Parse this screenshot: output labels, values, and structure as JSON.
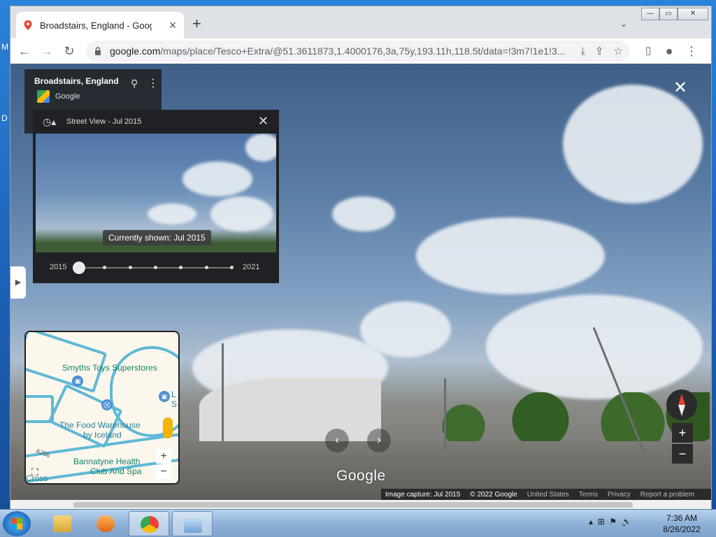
{
  "desktop": {
    "letter_m": "M",
    "letter_d": "D"
  },
  "browser": {
    "tab": {
      "title": "Broadstairs, England - Google Maps",
      "close": "✕"
    },
    "newtab": "+",
    "tab_search": "⌄",
    "window_controls": {
      "minimize": "—",
      "maximize": "▭",
      "close": "✕"
    },
    "nav": {
      "back": "←",
      "forward": "→",
      "reload": "↻"
    },
    "url": {
      "host": "google.com",
      "path": "/maps/place/Tesco+Extra/@51.3611873,1.4000176,3a,75y,193.11h,118.5t/data=!3m7!1e1!3..."
    }
  },
  "streetview": {
    "close": "✕",
    "place": {
      "title": "Broadstairs, England",
      "brand": "Google"
    },
    "time_machine": {
      "title": "Street View - Jul 2015",
      "tooltip": "Currently shown: Jul 2015",
      "year_start": "2015",
      "year_end": "2021",
      "stops": 7,
      "selected_index": 0
    },
    "minimap": {
      "labels": {
        "smyths": "Smyths Toys Superstores",
        "food_warehouse": "The Food Warehouse",
        "by_iceland": "by Iceland",
        "bannatyne": "Bannatyne Health",
        "club_spa": "Club And Spa",
        "road": "A256",
        "cross": "Cross",
        "partial_l": "L",
        "partial_s": "S"
      },
      "zoom_in": "+",
      "zoom_out": "−"
    },
    "logo": "Google",
    "footer": {
      "capture": "Image capture: Jul 2015",
      "copyright": "© 2022 Google",
      "country": "United States",
      "terms": "Terms",
      "privacy": "Privacy",
      "report": "Report a problem"
    },
    "zoom_in": "+",
    "zoom_out": "−",
    "nav_left": "‹",
    "nav_right": "›"
  },
  "taskbar": {
    "time": "7:36 AM",
    "date": "8/26/2022"
  }
}
